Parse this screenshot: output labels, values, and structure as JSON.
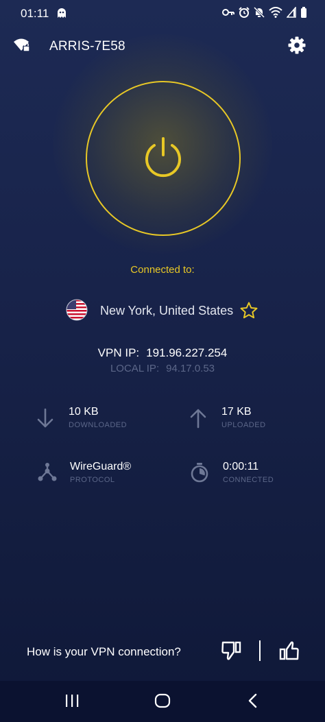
{
  "status_bar": {
    "time": "01:11",
    "icons": [
      "ghost-icon",
      "key-icon",
      "alarm-icon",
      "mute-icon",
      "wifi-icon",
      "signal-icon",
      "battery-icon"
    ]
  },
  "header": {
    "network_name": "ARRIS-7E58",
    "wifi_icon": "wifi-secure-icon",
    "settings_icon": "gear-icon"
  },
  "connection": {
    "status_label": "Connected to:",
    "location": "New York, United States",
    "flag_icon": "us-flag-icon",
    "favorite_icon": "star-outline-icon",
    "vpn_ip_label": "VPN IP:",
    "vpn_ip": "191.96.227.254",
    "local_ip_label": "LOCAL IP:",
    "local_ip": "94.17.0.53"
  },
  "stats": {
    "downloaded_value": "10 KB",
    "downloaded_caption": "DOWNLOADED",
    "uploaded_value": "17 KB",
    "uploaded_caption": "UPLOADED",
    "protocol_value": "WireGuard®",
    "protocol_caption": "PROTOCOL",
    "connected_value": "0:00:11",
    "connected_caption": "CONNECTED"
  },
  "feedback": {
    "question": "How is your VPN connection?"
  },
  "colors": {
    "accent": "#e8c826",
    "background": "#18234a",
    "muted_text": "#5c6789"
  }
}
